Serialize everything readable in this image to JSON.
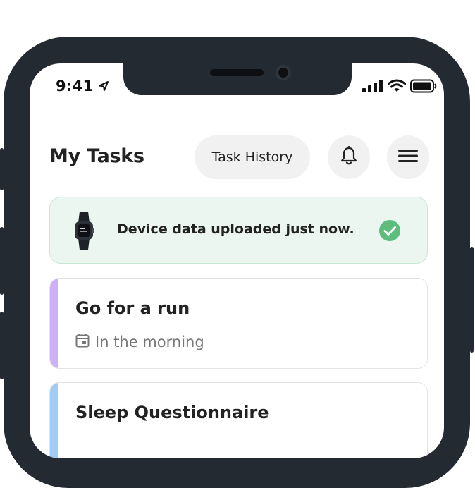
{
  "status_bar": {
    "time": "9:41",
    "icons": [
      "location-arrow-icon",
      "cellular-signal-icon",
      "wifi-icon",
      "battery-icon"
    ]
  },
  "header": {
    "title": "My Tasks",
    "task_history_label": "Task History",
    "icons": [
      "bell-icon",
      "hamburger-menu-icon"
    ]
  },
  "banner": {
    "message": "Device data uploaded just now.",
    "icons": [
      "fitness-band-icon",
      "check-circle-icon"
    ],
    "accent_color": "#5cbd7d"
  },
  "tasks": [
    {
      "title": "Go for a run",
      "schedule": "In the morning",
      "accent_color": "#cdb0f5",
      "icon": "calendar-icon"
    },
    {
      "title": "Sleep Questionnaire",
      "accent_color": "#9fcdf5"
    }
  ],
  "colors": {
    "device_frame": "#242a31",
    "button_background": "#f1f1f1",
    "banner_background": "#ebf6f0"
  }
}
